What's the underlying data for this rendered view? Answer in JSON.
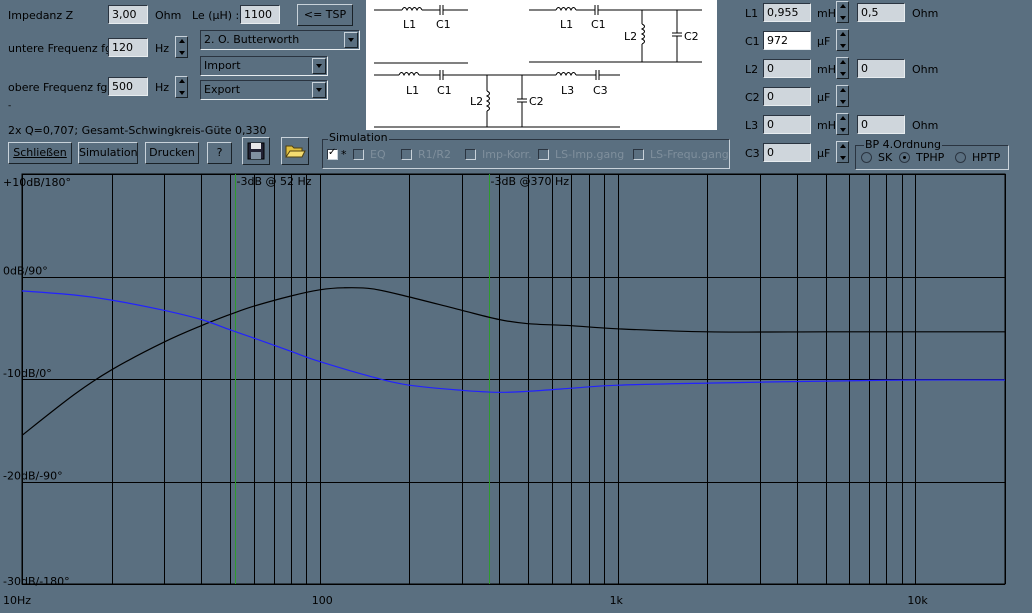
{
  "left_panel": {
    "impedanz_label": "Impedanz Z",
    "impedanz_value": "3,00",
    "impedanz_unit": "Ohm",
    "le_label": "Le (µH) :",
    "le_value": "1100",
    "tsp_button": "<= TSP",
    "fgu_label": "untere Frequenz fgu",
    "fgu_value": "120",
    "fgu_unit": "Hz",
    "fgo_label": "obere Frequenz fgo",
    "fgo_value": "500",
    "fgo_unit": "Hz",
    "filter_type": "2. O. Butterworth",
    "import_label": "Import",
    "export_label": "Export",
    "dot": "-",
    "summary": "2x Q=0,707; Gesamt-Schwingkreis-Güte 0,330"
  },
  "buttons": {
    "close": "Schließen",
    "simulation": "Simulation",
    "print": "Drucken",
    "help": "?",
    "save_icon": "floppy-disk-icon",
    "open_icon": "open-folder-icon"
  },
  "simulation_group": {
    "title": "Simulation",
    "items": [
      {
        "label": "*",
        "checked": true
      },
      {
        "label": "EQ",
        "checked": false
      },
      {
        "label": "R1/R2",
        "checked": false
      },
      {
        "label": "Imp-Korr.",
        "checked": false
      },
      {
        "label": "LS-Imp.gang",
        "checked": false
      },
      {
        "label": "LS-Frequ.gang",
        "checked": false
      }
    ]
  },
  "circuit": {
    "labels": {
      "a_l1": "L1",
      "a_c1": "C1",
      "b_l1": "L1",
      "b_c1": "C1",
      "b_l2": "L2",
      "b_c2": "C2",
      "c_l1": "L1",
      "c_c1": "C1",
      "c_l2": "L2",
      "c_c2": "C2",
      "c_l3": "L3",
      "c_c3": "C3"
    }
  },
  "components": {
    "rows": [
      {
        "name": "L1",
        "value": "0,955",
        "unit": "mH",
        "r_value": "0,5",
        "r_unit": "Ohm"
      },
      {
        "name": "C1",
        "value": "972",
        "unit": "µF"
      },
      {
        "name": "L2",
        "value": "0",
        "unit": "mH",
        "r_value": "0",
        "r_unit": "Ohm"
      },
      {
        "name": "C2",
        "value": "0",
        "unit": "µF"
      },
      {
        "name": "L3",
        "value": "0",
        "unit": "mH",
        "r_value": "0",
        "r_unit": "Ohm"
      },
      {
        "name": "C3",
        "value": "0",
        "unit": "µF"
      }
    ]
  },
  "bp_group": {
    "title": "BP 4.Ordnung",
    "options": [
      {
        "label": "SK",
        "selected": false
      },
      {
        "label": "TPHP",
        "selected": true
      },
      {
        "label": "HPTP",
        "selected": false
      }
    ]
  },
  "chart_data": {
    "type": "line",
    "x_scale": "log",
    "xlim": [
      10,
      20000
    ],
    "ylim": [
      -30,
      10
    ],
    "x_ticks": [
      {
        "value": 10,
        "label": "10Hz"
      },
      {
        "value": 100,
        "label": "100"
      },
      {
        "value": 1000,
        "label": "1k"
      },
      {
        "value": 10000,
        "label": "10k"
      }
    ],
    "y_ticks": [
      {
        "value": 10,
        "label": "+10dB/180°"
      },
      {
        "value": 0,
        "label": "0dB/90°"
      },
      {
        "value": -10,
        "label": "-10dB/0°"
      },
      {
        "value": -20,
        "label": "-20dB/-90°"
      },
      {
        "value": -30,
        "label": "-30dB/-180°"
      }
    ],
    "markers": [
      {
        "x": 52,
        "label": "-3dB @  52 Hz",
        "color": "#2e9a2e"
      },
      {
        "x": 370,
        "label": "-3dB @370 Hz",
        "color": "#2e9a2e"
      }
    ],
    "series": [
      {
        "color": "#000000",
        "x": [
          10,
          15,
          20,
          30,
          40,
          50,
          60,
          80,
          100,
          120,
          150,
          200,
          300,
          400,
          500,
          700,
          1000,
          2000,
          5000,
          10000,
          20000
        ],
        "y": [
          -15.5,
          -11.5,
          -9.1,
          -6.4,
          -4.8,
          -3.7,
          -2.9,
          -1.9,
          -1.3,
          -1.1,
          -1.2,
          -2.0,
          -3.3,
          -4.2,
          -4.6,
          -4.8,
          -5.1,
          -5.4,
          -5.4,
          -5.4,
          -5.4
        ]
      },
      {
        "color": "#2222ff",
        "x": [
          10,
          15,
          20,
          30,
          40,
          50,
          60,
          80,
          100,
          150,
          200,
          300,
          400,
          500,
          700,
          1000,
          2000,
          5000,
          10000,
          20000
        ],
        "y": [
          -1.4,
          -1.8,
          -2.3,
          -3.3,
          -4.2,
          -5.2,
          -6.0,
          -7.3,
          -8.3,
          -9.8,
          -10.6,
          -11.1,
          -11.3,
          -11.2,
          -10.9,
          -10.6,
          -10.4,
          -10.2,
          -10.1,
          -10.1
        ]
      }
    ]
  }
}
